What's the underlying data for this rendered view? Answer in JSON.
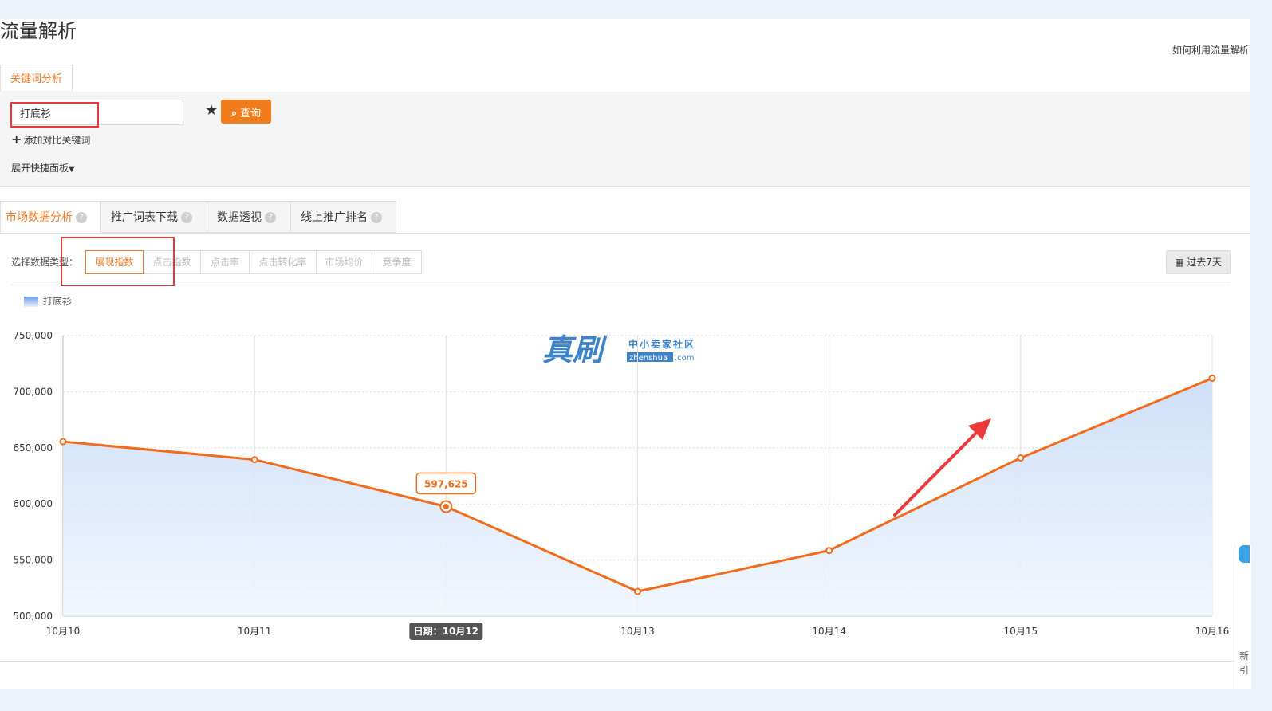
{
  "page": {
    "title": "流量解析",
    "help_link": "如何利用流量解析"
  },
  "top_tab": {
    "label": "关键词分析"
  },
  "search": {
    "keyword": "打底衫",
    "query_label": "查询",
    "add_compare": "添加对比关键词",
    "expand_panel": "展开快捷面板"
  },
  "sub_tabs": [
    "市场数据分析",
    "推广词表下载",
    "数据透视",
    "线上推广排名"
  ],
  "data_type": {
    "label": "选择数据类型：",
    "options": [
      "展现指数",
      "点击指数",
      "点击率",
      "点击转化率",
      "市场均价",
      "竞争度"
    ],
    "selected": "展现指数"
  },
  "period": {
    "label": "过去7天"
  },
  "side": {
    "t1": "新",
    "t2": "引"
  },
  "colors": {
    "accent": "#f07c2a",
    "line": "#f26b1d",
    "annotation": "#e9373c"
  },
  "chart_data": {
    "type": "area",
    "x": [
      "10月10",
      "10月11",
      "10月12",
      "10月13",
      "10月14",
      "10月15",
      "10月16"
    ],
    "series": [
      {
        "name": "打底衫",
        "values": [
          655500,
          639500,
          597625,
          522000,
          558500,
          641000,
          712000
        ]
      }
    ],
    "ylim": [
      500000,
      750000
    ],
    "yticks": [
      "750,000",
      "700,000",
      "650,000",
      "600,000",
      "550,000",
      "500,000"
    ],
    "tooltip": {
      "index": 2,
      "value_label": "597,625",
      "x_label": "日期：10月12"
    },
    "grid": true,
    "legend": "top-left",
    "watermark": {
      "main": "真刷",
      "sub": "中小卖家社区",
      "domain": "zhenshua",
      "suffix": ".com"
    }
  }
}
